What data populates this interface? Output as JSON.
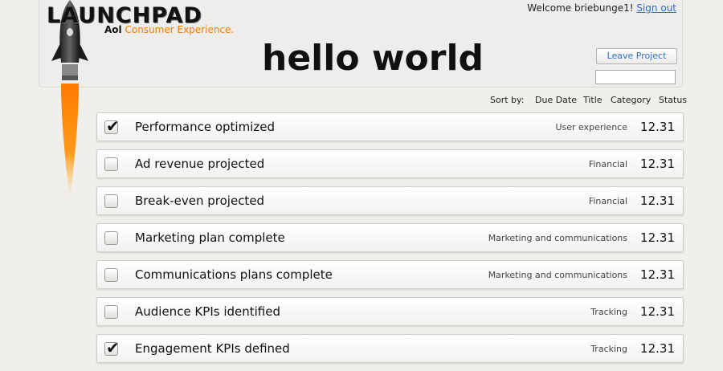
{
  "logo": {
    "title": "LAUNCHPAD",
    "aol": "Aol",
    "subtitle": "Consumer Experience."
  },
  "header": {
    "welcome_text": "Welcome briebunge1!",
    "sign_out_label": "Sign out",
    "page_title": "hello world",
    "leave_button_label": "Leave Project",
    "input_value": ""
  },
  "sort": {
    "label": "Sort by:",
    "options": [
      "Due Date",
      "Title",
      "Category",
      "Status"
    ]
  },
  "tasks": [
    {
      "title": "Performance optimized",
      "category": "User experience",
      "date": "12.31",
      "checked": true
    },
    {
      "title": "Ad revenue projected",
      "category": "Financial",
      "date": "12.31",
      "checked": false
    },
    {
      "title": "Break-even projected",
      "category": "Financial",
      "date": "12.31",
      "checked": false
    },
    {
      "title": "Marketing plan complete",
      "category": "Marketing and communications",
      "date": "12.31",
      "checked": false
    },
    {
      "title": "Communications plans complete",
      "category": "Marketing and communications",
      "date": "12.31",
      "checked": false
    },
    {
      "title": "Audience KPIs identified",
      "category": "Tracking",
      "date": "12.31",
      "checked": false
    },
    {
      "title": "Engagement KPIs defined",
      "category": "Tracking",
      "date": "12.31",
      "checked": true
    }
  ],
  "colors": {
    "accent_orange": "#f07d00",
    "link_blue": "#2b6cc4"
  }
}
